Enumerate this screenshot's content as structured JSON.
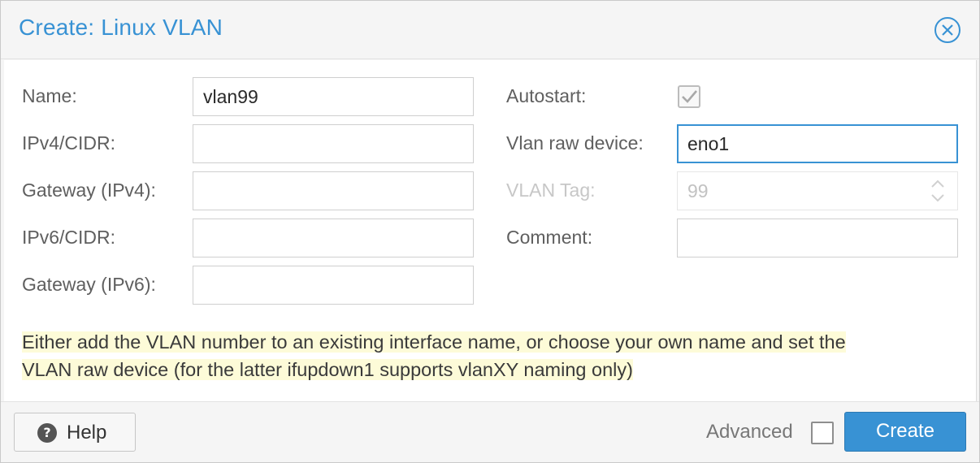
{
  "dialog": {
    "title": "Create: Linux VLAN",
    "close_icon": "close-circle-icon"
  },
  "form": {
    "left": [
      {
        "label": "Name:",
        "value": "vlan99"
      },
      {
        "label": "IPv4/CIDR:",
        "value": ""
      },
      {
        "label": "Gateway (IPv4):",
        "value": ""
      },
      {
        "label": "IPv6/CIDR:",
        "value": ""
      },
      {
        "label": "Gateway (IPv6):",
        "value": ""
      }
    ],
    "right": {
      "autostart": {
        "label": "Autostart:",
        "checked": true
      },
      "vlan_raw_device": {
        "label": "Vlan raw device:",
        "value": "eno1"
      },
      "vlan_tag": {
        "label": "VLAN Tag:",
        "value": "99",
        "disabled": true
      },
      "comment": {
        "label": "Comment:",
        "value": ""
      }
    }
  },
  "hint": {
    "line1": "Either add the VLAN number to an existing interface name, or choose your own name and set the",
    "line2": "VLAN raw device (for the latter ifupdown1 supports vlanXY naming only)"
  },
  "footer": {
    "help_label": "Help",
    "help_icon": "question-circle-icon",
    "advanced_label": "Advanced",
    "advanced_checked": false,
    "create_label": "Create"
  },
  "colors": {
    "accent": "#3892d4",
    "hint_background": "#fdfbd8"
  }
}
